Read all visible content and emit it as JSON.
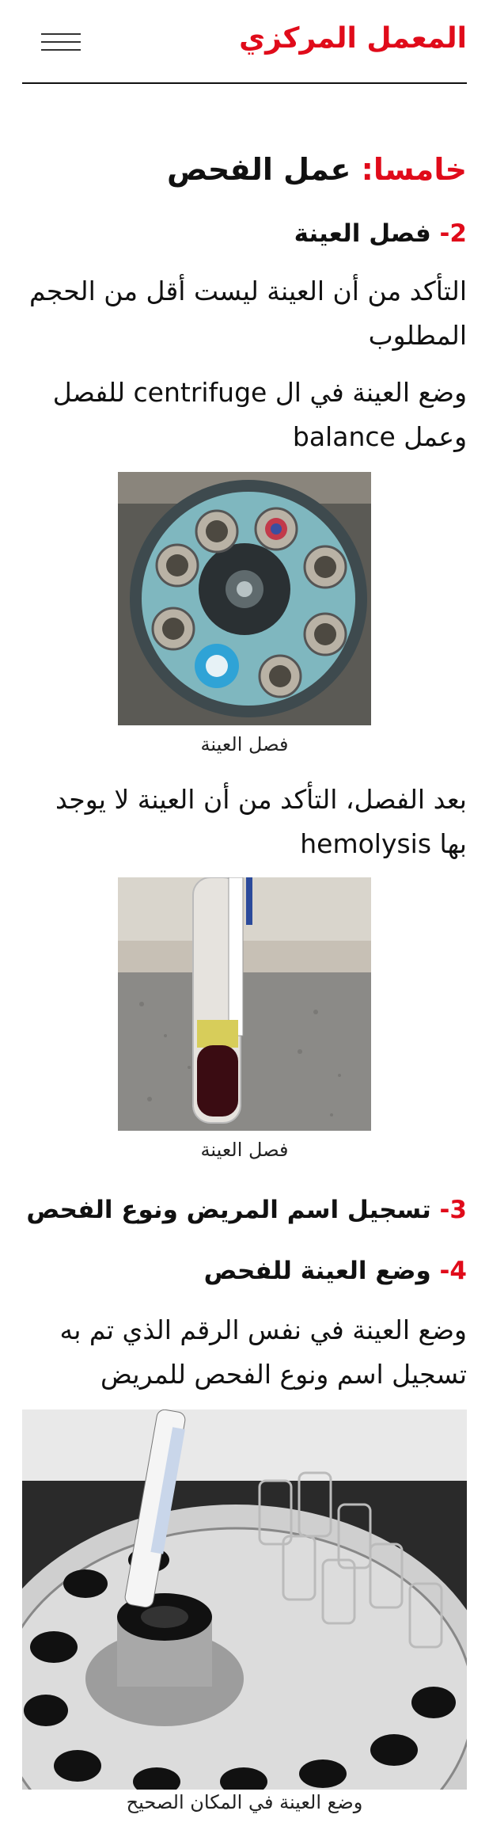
{
  "header": {
    "brand": "المعمل المركزي",
    "menu_icon": "hamburger-menu-icon"
  },
  "section": {
    "title_prefix": "خامسا:",
    "title_rest": " عمل الفحص"
  },
  "steps": [
    {
      "number": "2-",
      "title": " فصل العينة",
      "paragraphs": [
        "التأكد من أن العينة ليست أقل من الحجم المطلوب",
        "وضع العينة في ال centrifuge للفصل وعمل balance"
      ],
      "figure_caption": "فصل العينة",
      "after_text": "بعد الفصل، التأكد من أن العينة لا يوجد بها hemolysis",
      "figure2_caption": "فصل العينة"
    },
    {
      "number": "3-",
      "title": " تسجيل اسم المريض ونوع الفحص"
    },
    {
      "number": "4-",
      "title": " وضع العينة للفحص",
      "paragraph": "وضع العينة في نفس الرقم الذي تم به تسجيل اسم ونوع الفحص للمريض",
      "figure_caption": "وضع العينة في المكان الصحيح"
    }
  ],
  "colors": {
    "accent": "#e00b1a",
    "text": "#111111"
  }
}
